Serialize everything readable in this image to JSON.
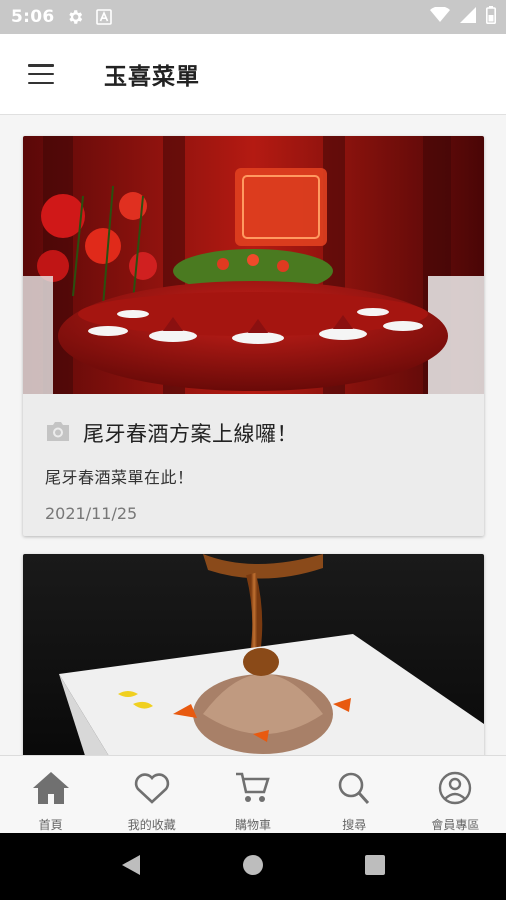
{
  "status_bar": {
    "time": "5:06"
  },
  "app_bar": {
    "title": "玉喜菜單"
  },
  "feed": {
    "cards": [
      {
        "title": "尾牙春酒方案上線囉！",
        "subtitle": "尾牙春酒菜單在此！",
        "date": "2021/11/25",
        "icon": "camera-icon"
      },
      {
        "icon": "camera-icon"
      }
    ]
  },
  "bottom_nav": {
    "items": [
      {
        "label": "首頁",
        "icon": "home-icon"
      },
      {
        "label": "我的收藏",
        "icon": "heart-icon"
      },
      {
        "label": "購物車",
        "icon": "cart-icon"
      },
      {
        "label": "搜尋",
        "icon": "search-icon"
      },
      {
        "label": "會員專區",
        "icon": "account-icon"
      }
    ]
  },
  "colors": {
    "status_bar": "#c8c8c8",
    "card_bg": "#ececec",
    "accent_red": "#b01818"
  }
}
